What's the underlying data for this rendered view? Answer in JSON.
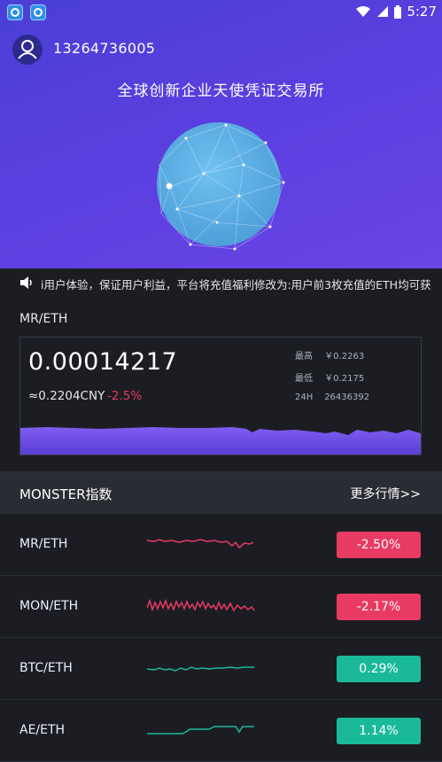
{
  "status_bar": {
    "time": "5:27"
  },
  "header": {
    "phone": "13264736005",
    "title": "全球创新企业天使凭证交易所"
  },
  "ticker": {
    "text": "i用户体验，保证用户利益，平台将充值福利修改为:用户前3枚充值的ETH均可获"
  },
  "market": {
    "pair": "MR/ETH",
    "price": "0.00014217",
    "cny": "≈0.2204CNY",
    "change": "-2.5%",
    "stats": [
      {
        "label": "最高",
        "value": "￥0.2263"
      },
      {
        "label": "最低",
        "value": "￥0.2175"
      },
      {
        "label": "24H",
        "value": "26436392"
      }
    ]
  },
  "index": {
    "title": "MONSTER指数",
    "more": "更多行情>>",
    "rows": [
      {
        "pair": "MR/ETH",
        "change": "-2.50%",
        "trend": "down"
      },
      {
        "pair": "MON/ETH",
        "change": "-2.17%",
        "trend": "down"
      },
      {
        "pair": "BTC/ETH",
        "change": "0.29%",
        "trend": "up"
      },
      {
        "pair": "AE/ETH",
        "change": "1.14%",
        "trend": "up"
      }
    ]
  },
  "colors": {
    "up": "#1ab99a",
    "down": "#e93a63",
    "hero": "#5a3fe0"
  }
}
